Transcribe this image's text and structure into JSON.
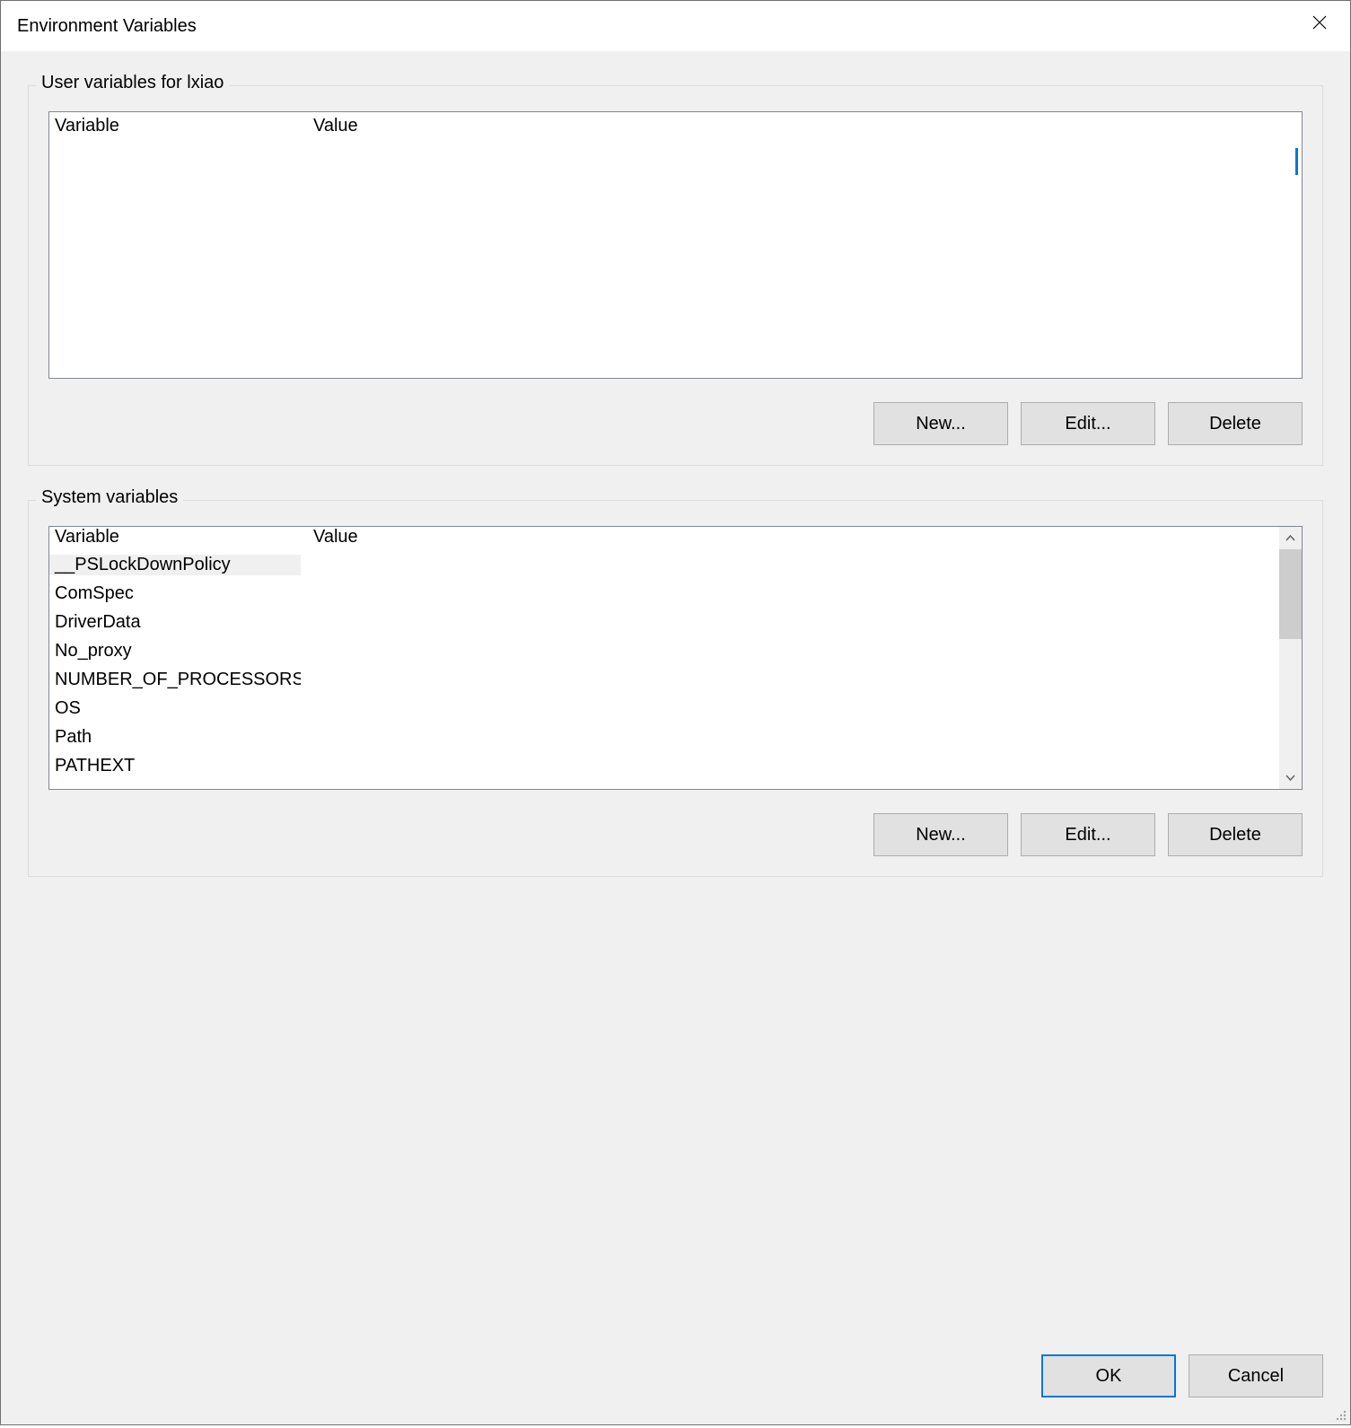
{
  "title": "Environment Variables",
  "userGroup": {
    "label": "User variables for lxiao",
    "columns": {
      "variable": "Variable",
      "value": "Value"
    },
    "rows": [],
    "buttons": {
      "new": "New...",
      "edit": "Edit...",
      "delete": "Delete"
    }
  },
  "systemGroup": {
    "label": "System variables",
    "columns": {
      "variable": "Variable",
      "value": "Value"
    },
    "rows": [
      {
        "variable": "__PSLockDownPolicy",
        "value": "",
        "selected": true
      },
      {
        "variable": "ComSpec",
        "value": ""
      },
      {
        "variable": "DriverData",
        "value": ""
      },
      {
        "variable": "No_proxy",
        "value": ""
      },
      {
        "variable": "NUMBER_OF_PROCESSORS",
        "value": ""
      },
      {
        "variable": "OS",
        "value": ""
      },
      {
        "variable": "Path",
        "value": ""
      },
      {
        "variable": "PATHEXT",
        "value": ""
      }
    ],
    "buttons": {
      "new": "New...",
      "edit": "Edit...",
      "delete": "Delete"
    }
  },
  "dialogButtons": {
    "ok": "OK",
    "cancel": "Cancel"
  }
}
